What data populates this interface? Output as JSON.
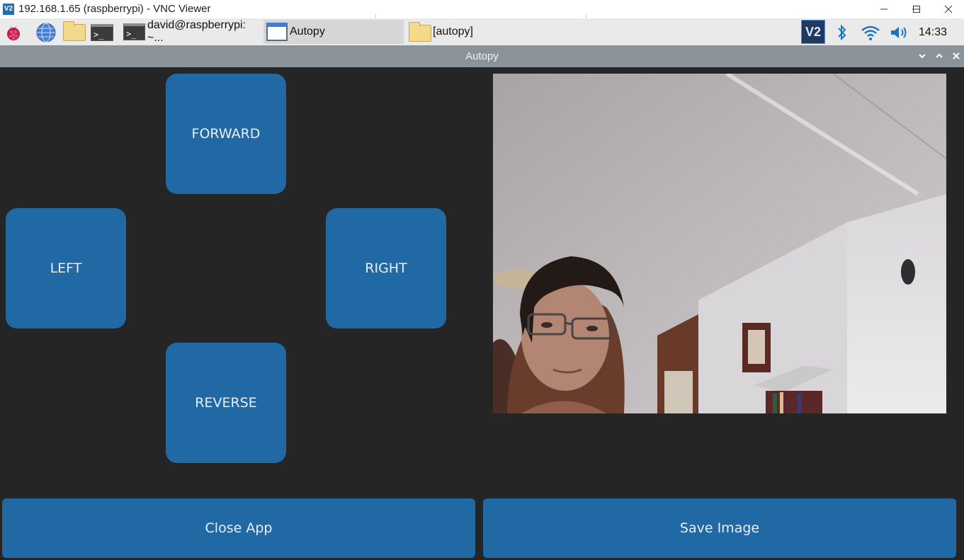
{
  "vnc_window": {
    "logo_text": "V2",
    "title": "192.168.1.65 (raspberrypi) - VNC Viewer"
  },
  "taskbar": {
    "tasks": [
      {
        "label": "david@raspberrypi: ~...",
        "icon": "terminal-icon"
      },
      {
        "label": "Autopy",
        "icon": "window-icon"
      },
      {
        "label": "[autopy]",
        "icon": "folder-icon"
      }
    ],
    "tray": {
      "vnc_text": "V2",
      "clock": "14:33"
    }
  },
  "app": {
    "title": "Autopy",
    "controls": {
      "forward": "FORWARD",
      "left": "LEFT",
      "right": "RIGHT",
      "reverse": "REVERSE"
    },
    "buttons": {
      "close": "Close App",
      "save": "Save Image"
    }
  },
  "colors": {
    "button_blue": "#2069a4",
    "app_background": "#252525",
    "app_titlebar": "#8a9399",
    "taskbar": "#eaeaea"
  }
}
